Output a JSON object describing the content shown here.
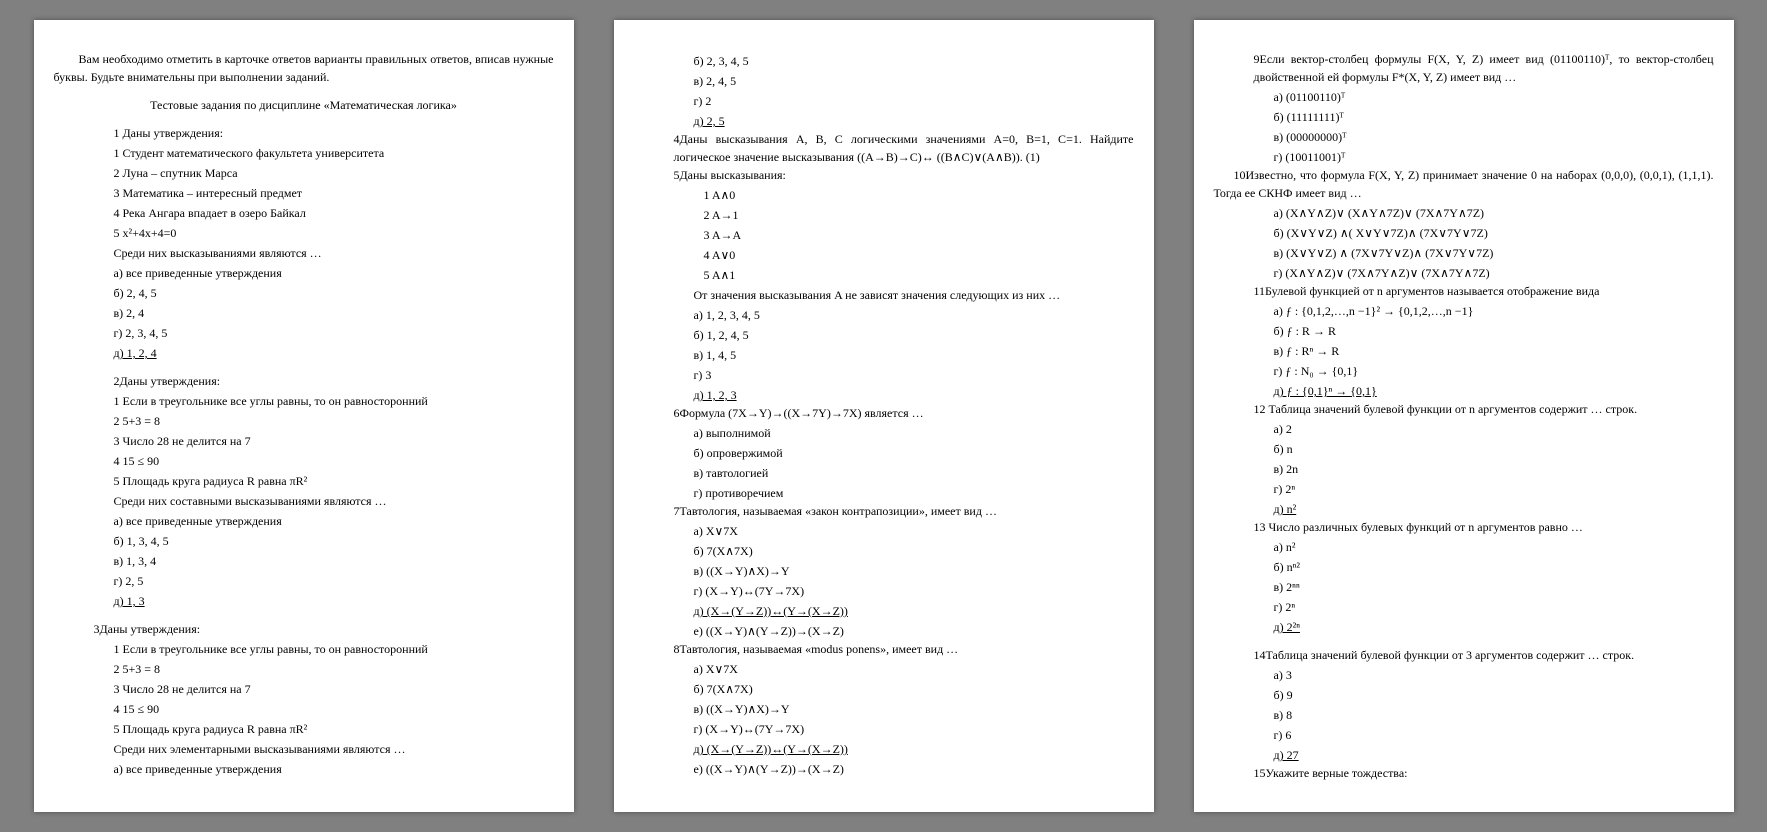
{
  "intro": "Вам необходимо отметить в карточке ответов варианты правильных ответов, вписав нужные буквы. Будьте внимательны при выполнении заданий.",
  "title": "Тестовые задания по дисциплине «Математическая логика»",
  "p1": {
    "q1": {
      "stem": "1 Даны утверждения:",
      "s1": "1 Студент математического факультета университета",
      "s2": "2 Луна – спутник Марса",
      "s3": "3 Математика – интересный предмет",
      "s4": "4 Река Ангара впадает в озеро Байкал",
      "s5": "5 x²+4x+4=0",
      "after": "Среди них высказываниями являются …",
      "a": "а) все приведенные утверждения",
      "b": "б) 2, 4, 5",
      "c": "в) 2, 4",
      "d": "г) 2, 3, 4, 5",
      "e": "д) 1, 2, 4"
    },
    "q2": {
      "stem": "2Даны утверждения:",
      "s1": "1 Если в треугольнике все углы равны, то он равносторонний",
      "s2": "2 5+3 = 8",
      "s3": "3 Число 28 не делится на 7",
      "s4": "4 15 ≤ 90",
      "s5": "5 Площадь круга радиуса R равна πR²",
      "after": "Среди них составными высказываниями являются …",
      "a": "а) все приведенные утверждения",
      "b": "б) 1, 3, 4, 5",
      "c": "в) 1, 3, 4",
      "d": "г) 2, 5",
      "e": "д) 1, 3"
    },
    "q3": {
      "stem": "3Даны утверждения:",
      "s1": "1 Если в треугольнике все углы равны, то он равносторонний",
      "s2": "2 5+3 = 8",
      "s3": "3 Число 28 не делится на 7",
      "s4": "4 15 ≤ 90",
      "s5": "5 Площадь круга радиуса R равна πR²",
      "after": "Среди них элементарными высказываниями являются …",
      "a": "а) все приведенные утверждения"
    }
  },
  "p2": {
    "start": {
      "b": "б) 2, 3, 4, 5",
      "c": "в) 2, 4, 5",
      "d": "г) 2",
      "e": "д) 2, 5"
    },
    "q4": "4Даны высказывания A, B, C логическими значениями A=0, B=1, C=1. Найдите логическое значение высказывания ((A→B)→C)↔ ((B∧C)∨(A∧B)). (1)",
    "q5": {
      "stem": "5Даны высказывания:",
      "s1": "1 A∧0",
      "s2": "2 A→1",
      "s3": "3 A→A",
      "s4": "4 A∨0",
      "s5": "5 A∧1",
      "after": "От значения высказывания A не зависят значения следующих из них …",
      "a": "а) 1, 2, 3, 4, 5",
      "b": "б) 1, 2, 4, 5",
      "c": "в) 1, 4, 5",
      "d": "г) 3",
      "e": "д) 1, 2, 3"
    },
    "q6": {
      "stem": "6Формула (7X→Y)→((X→7Y)→7X) является …",
      "a": "а) выполнимой",
      "b": "б) опровержимой",
      "c": "в) тавтологией",
      "d": "г) противоречием"
    },
    "q7": {
      "stem": "7Тавтология, называемая «закон контрапозиции», имеет вид …",
      "a": "а) X∨7X",
      "b": "б) 7(X∧7X)",
      "c": "в) ((X→Y)∧X)→Y",
      "d": "г) (X→Y)↔(7Y→7X)",
      "e": "д) (X→(Y→Z))↔(Y→(X→Z))",
      "f": "е) ((X→Y)∧(Y→Z))→(X→Z)"
    },
    "q8": {
      "stem": "8Тавтология, называемая «modus ponens», имеет вид …",
      "a": "а) X∨7X",
      "b": "б) 7(X∧7X)",
      "c": "в) ((X→Y)∧X)→Y",
      "d": "г) (X→Y)↔(7Y→7X)",
      "e": "д) (X→(Y→Z))↔(Y→(X→Z))",
      "f": "е) ((X→Y)∧(Y→Z))→(X→Z)"
    }
  },
  "p3": {
    "q9": {
      "stem": "9Если вектор-столбец формулы F(X, Y, Z) имеет вид (01100110)ᵀ, то вектор-столбец двойственной ей формулы F*(X, Y, Z) имеет вид …",
      "a": "а) (01100110)ᵀ",
      "b": "б) (11111111)ᵀ",
      "c": "в) (00000000)ᵀ",
      "d": "г) (10011001)ᵀ"
    },
    "q10": {
      "stem": "10Известно, что формула F(X, Y, Z) принимает значение 0 на наборах (0,0,0), (0,0,1), (1,1,1). Тогда ее СКНФ имеет вид …",
      "a": "а) (X∧Y∧Z)∨ (X∧Y∧7Z)∨ (7X∧7Y∧7Z)",
      "b": "б) (X∨Y∨Z) ∧( X∨Y∨7Z)∧ (7X∨7Y∨7Z)",
      "c": "в) (X∨Y∨Z) ∧ (7X∨7Y∨Z)∧ (7X∨7Y∨7Z)",
      "d": "г) (X∧Y∧Z)∨ (7X∧7Y∧Z)∨ (7X∧7Y∧7Z)"
    },
    "q11": {
      "stem": "11Булевой функцией от n аргументов называется отображение вида",
      "a": "а) ƒ : {0,1,2,…,n −1}² → {0,1,2,…,n −1}",
      "b": "б) ƒ : R → R",
      "c": "в) ƒ : Rⁿ → R",
      "d": "г) ƒ : N₀ → {0,1}",
      "e": "д) ƒ : {0,1}ⁿ → {0,1}"
    },
    "q12": {
      "stem": "12 Таблица значений булевой функции от n аргументов содержит … строк.",
      "a": "а) 2",
      "b": "б) n",
      "c": "в) 2n",
      "d": "г) 2ⁿ",
      "e": "д) n²"
    },
    "q13": {
      "stem": "13 Число различных булевых функций от n аргументов равно …",
      "a": "а) n²",
      "b": "б) nⁿ²",
      "c": "в) 2ⁿⁿ",
      "d": "г) 2ⁿ",
      "e": "д) 2²ⁿ"
    },
    "q14": {
      "stem": "14Таблица значений булевой функции от 3 аргументов содержит … строк.",
      "a": "а) 3",
      "b": "б) 9",
      "c": "в) 8",
      "d": "г) 6",
      "e": "д) 27"
    },
    "q15": "15Укажите верные тождества:"
  }
}
